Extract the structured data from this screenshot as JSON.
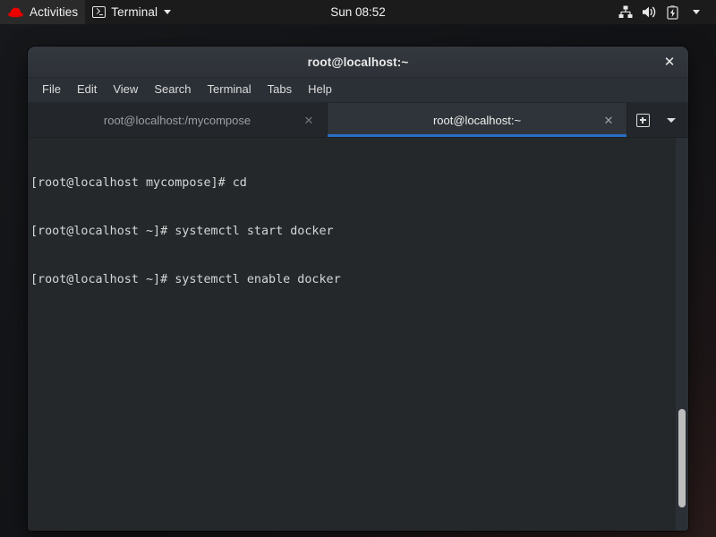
{
  "topbar": {
    "logo_name": "red-hat-logo",
    "activities_label": "Activities",
    "app_icon_name": "terminal-icon",
    "app_label": "Terminal",
    "app_menu_caret": "▾",
    "clock": "Sun 08:52",
    "tray": [
      {
        "name": "network-wired-icon",
        "title": "Network"
      },
      {
        "name": "volume-icon",
        "title": "Volume"
      },
      {
        "name": "battery-charging-icon",
        "title": "Battery"
      },
      {
        "name": "chevron-down-icon",
        "title": "System menu"
      }
    ]
  },
  "window": {
    "title": "root@localhost:~",
    "close_label": "✕",
    "menu": [
      "File",
      "Edit",
      "View",
      "Search",
      "Terminal",
      "Tabs",
      "Help"
    ],
    "tabs": [
      {
        "label": "root@localhost:/mycompose",
        "active": false,
        "close": "✕"
      },
      {
        "label": "root@localhost:~",
        "active": true,
        "close": "✕"
      }
    ],
    "tab_tools": {
      "new_tab_name": "new-tab-icon",
      "dropdown_name": "tab-list-dropdown-icon"
    }
  },
  "terminal": {
    "lines": [
      "[root@localhost mycompose]# cd",
      "[root@localhost ~]# systemctl start docker",
      "[root@localhost ~]# systemctl enable docker"
    ],
    "background": "#24282b",
    "foreground": "#d6d6d6",
    "scrollbar": {
      "thumb_top_pct": 69,
      "thumb_height_pct": 25
    }
  },
  "colors": {
    "accent_blue": "#2a6ec4",
    "titlebar": "#2f343a",
    "tabbar": "#23272b",
    "topbar": "#1b1b1b",
    "redhat_red": "#e00000"
  }
}
